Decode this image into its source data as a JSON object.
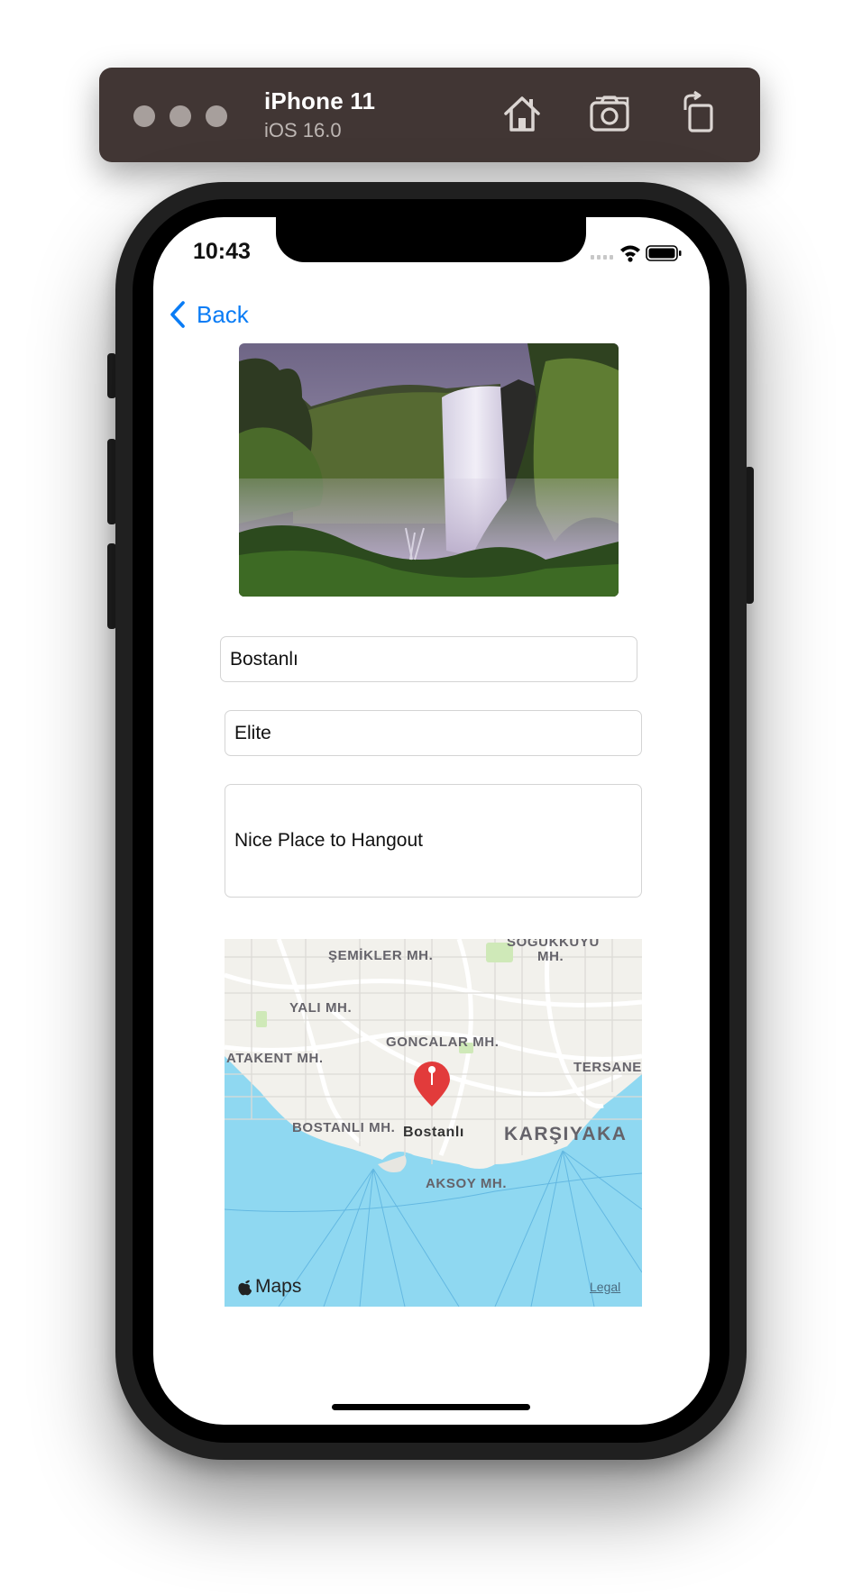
{
  "simulator": {
    "device_name": "iPhone 11",
    "os_version": "iOS 16.0",
    "buttons": [
      "home-icon",
      "screenshot-icon",
      "rotate-icon"
    ]
  },
  "status_bar": {
    "time": "10:43"
  },
  "nav": {
    "back_label": "Back"
  },
  "form": {
    "name": "Bostanlı",
    "type": "Elite",
    "comment": "Nice Place to Hangout"
  },
  "map": {
    "pin_title": "Bostanlı",
    "districts": {
      "semikler": "ŞEMİKLER MH.",
      "sogukkuyu_1": "SOĞUKKUYU",
      "sogukkuyu_2": "MH.",
      "yali": "YALI MH.",
      "goncalar": "GONCALAR MH.",
      "atakent": "ATAKENT MH.",
      "tersane": "TERSANE",
      "bostanli": "BOSTANLI MH.",
      "karsiyaka": "KARŞIYAKA",
      "aksoy": "AKSOY MH."
    },
    "attribution": "Maps",
    "legal": "Legal",
    "colors": {
      "water": "#8fd8f1",
      "land": "#f4f3ee",
      "pin": "#e23b3b"
    }
  },
  "accent_color": "#0a7cf5"
}
